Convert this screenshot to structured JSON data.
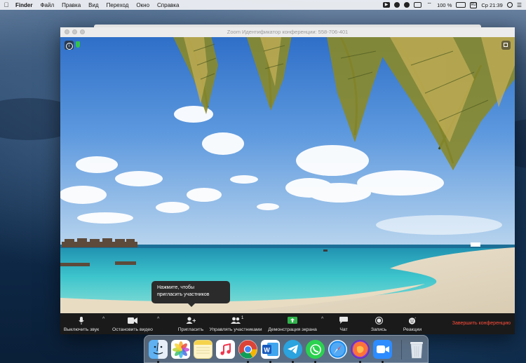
{
  "menubar": {
    "app_name": "Finder",
    "items": [
      "Файл",
      "Правка",
      "Вид",
      "Переход",
      "Окно",
      "Справка"
    ],
    "battery": "100 %",
    "clock": "Ср 21:39"
  },
  "window": {
    "title": "Zoom Идентификатор конференции: 558-706-401"
  },
  "tooltip": {
    "line1": "Нажмите, чтобы",
    "line2": "пригласить участников"
  },
  "toolbar": {
    "mute": "Выключить звук",
    "stop_video": "Остановить видео",
    "invite": "Пригласить",
    "participants": "Управлять участниками",
    "participants_count": "1",
    "share": "Демонстрация экрана",
    "chat": "Чат",
    "record": "Запись",
    "reactions": "Реакции",
    "end": "Завершить конференцию",
    "colors": {
      "end": "#ff4d3a",
      "share": "#2fb34a"
    }
  },
  "dock": {
    "apps": [
      "finder-icon",
      "photos-icon",
      "notes-icon",
      "music-icon",
      "chrome-icon",
      "word-icon",
      "telegram-icon",
      "whatsapp-icon",
      "safari-icon",
      "firefox-icon",
      "zoom-icon",
      "trash-icon"
    ]
  }
}
